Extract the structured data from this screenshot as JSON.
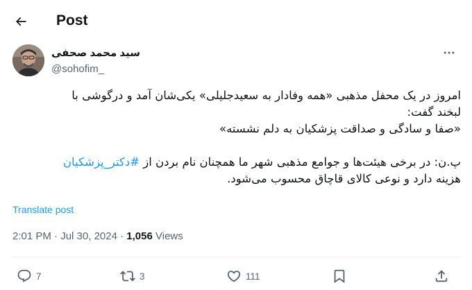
{
  "header": {
    "title": "Post"
  },
  "author": {
    "name": "سید محمد صحفی",
    "handle": "@sohofim_"
  },
  "tweet": {
    "lines": [
      "امروز در یک محفل مذهبی «همه وفادار به سعیدجلیلی» یکی‌شان آمد و درگوشی با",
      "لبخند گفت:",
      "«صفا و سادگی و صداقت پزشکیان به دلم نشسته»"
    ],
    "pn_prefix": "پ.ن: در برخی هیئت‌ها و جوامع مذهبی شهر ما همچنان نام بردن از ",
    "hashtag": "#دکتر_پزشکیان",
    "pn_line2": "هزینه دارد و نوعی کالای قاچاق محسوب می‌شود."
  },
  "translate_label": "Translate post",
  "meta": {
    "time": "2:01 PM",
    "separator": "·",
    "date": "Jul 30, 2024",
    "views_count": "1,056",
    "views_label": "Views"
  },
  "actions": {
    "replies": "7",
    "reposts": "3",
    "likes": "111"
  },
  "colors": {
    "text": "#0f1419",
    "secondary": "#536471",
    "link": "#1d9bf0",
    "divider": "#eff3f4"
  },
  "icons": [
    "back-arrow-icon",
    "more-icon",
    "reply-icon",
    "repost-icon",
    "like-icon",
    "bookmark-icon",
    "share-icon"
  ]
}
